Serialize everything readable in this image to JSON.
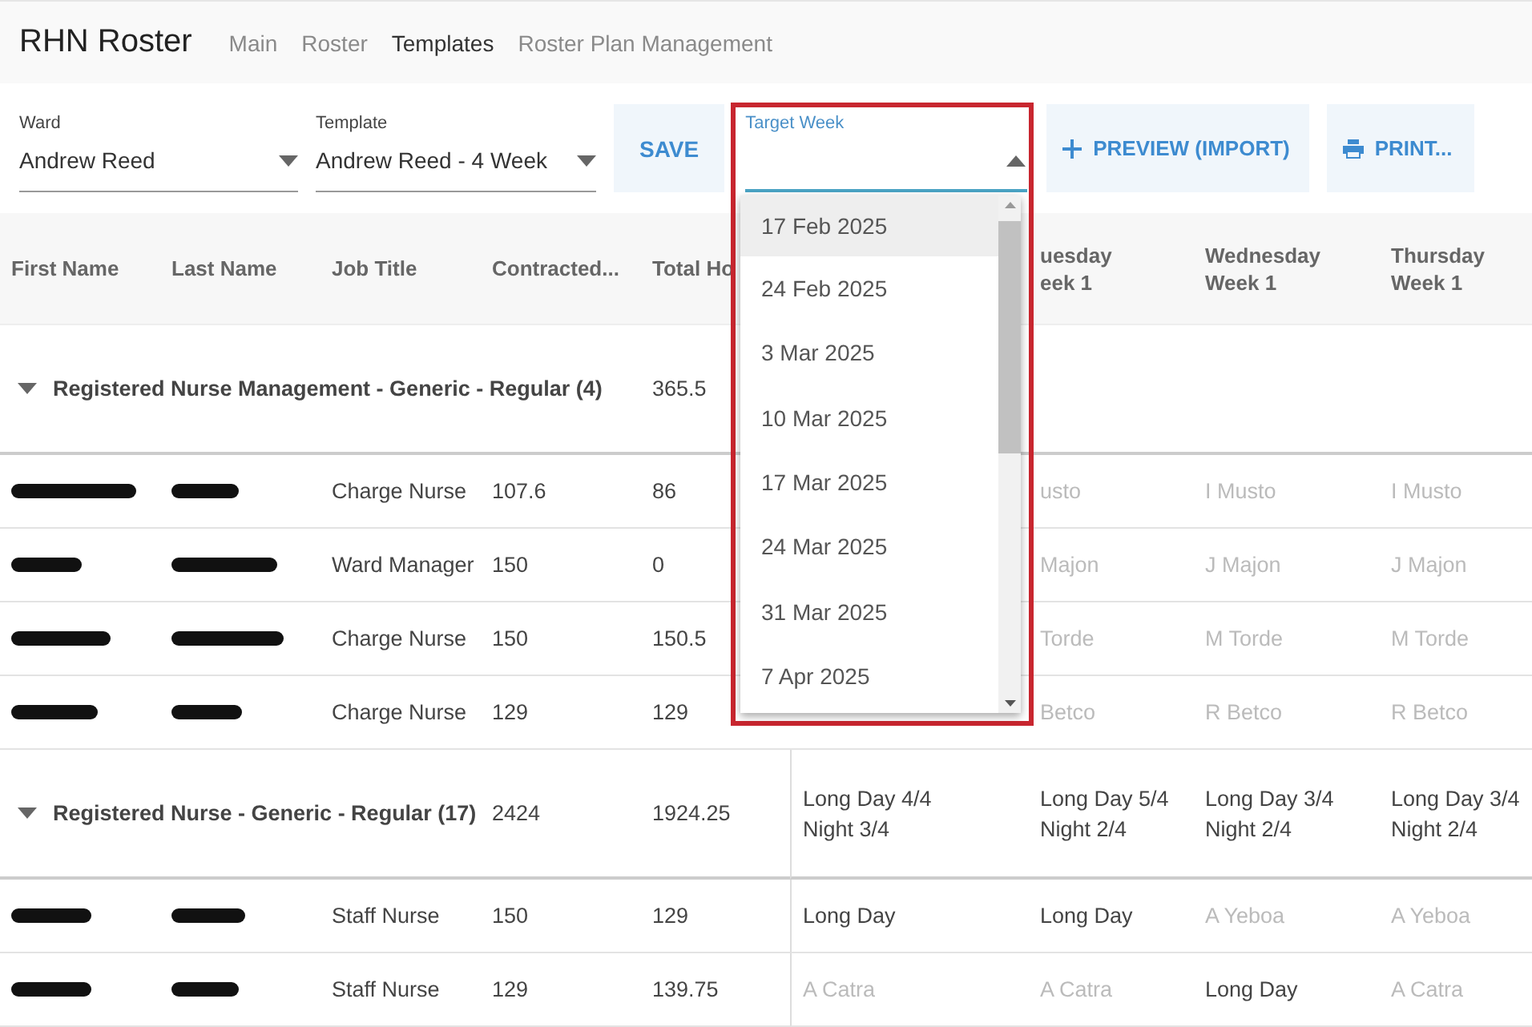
{
  "app": {
    "title": "RHN Roster"
  },
  "nav": [
    {
      "label": "Main",
      "selected": false
    },
    {
      "label": "Roster",
      "selected": false
    },
    {
      "label": "Templates",
      "selected": true
    },
    {
      "label": "Roster Plan Management",
      "selected": false
    }
  ],
  "toolbar": {
    "ward": {
      "label": "Ward",
      "value": "Andrew Reed"
    },
    "template": {
      "label": "Template",
      "value": "Andrew Reed - 4 Week"
    },
    "save_button": "SAVE",
    "target_week": {
      "label": "Target Week",
      "expanded": true,
      "annotation": {
        "kind": "outline"
      },
      "options": [
        {
          "label": "17 Feb 2025",
          "selected": true
        },
        {
          "label": "24 Feb 2025",
          "selected": false
        },
        {
          "label": "3 Mar 2025",
          "selected": false
        },
        {
          "label": "10 Mar 2025",
          "selected": false
        },
        {
          "label": "17 Mar 2025",
          "selected": false
        },
        {
          "label": "24 Mar 2025",
          "selected": false
        },
        {
          "label": "31 Mar 2025",
          "selected": false
        },
        {
          "label": "7 Apr 2025",
          "selected": false
        }
      ]
    },
    "preview_button": "PREVIEW (IMPORT)",
    "print_button": "PRINT..."
  },
  "table": {
    "columns": [
      {
        "label": "First Name"
      },
      {
        "label": "Last Name"
      },
      {
        "label": "Job Title"
      },
      {
        "label": "Contracted..."
      },
      {
        "label": "Total Ho"
      },
      {
        "covered": true
      },
      {
        "label": "uesday\neek 1"
      },
      {
        "label": "Wednesday\nWeek 1"
      },
      {
        "label": "Thursday\nWeek 1"
      }
    ],
    "rows": [
      {
        "kind": "group",
        "expanded": true,
        "label": "Registered Nurse Management - Generic - Regular (4)",
        "total": "365.5"
      },
      {
        "kind": "person",
        "name_redacted": true,
        "job_title": "Charge Nurse",
        "contracted": "107.6",
        "total": "86",
        "cells": {
          "column_7": {
            "text": "usto",
            "muted": true
          },
          "column_8": {
            "text": "I Musto",
            "muted": true
          },
          "column_9": {
            "text": "I Musto",
            "muted": true
          }
        }
      },
      {
        "kind": "person",
        "name_redacted": true,
        "job_title": "Ward Manager",
        "contracted": "150",
        "total": "0",
        "cells": {
          "column_7": {
            "text": "Majon",
            "muted": true
          },
          "column_8": {
            "text": "J Majon",
            "muted": true
          },
          "column_9": {
            "text": "J Majon",
            "muted": true
          }
        }
      },
      {
        "kind": "person",
        "name_redacted": true,
        "job_title": "Charge Nurse",
        "contracted": "150",
        "total": "150.5",
        "cells": {
          "column_7": {
            "text": "Torde",
            "muted": true
          },
          "column_8": {
            "text": "M Torde",
            "muted": true
          },
          "column_9": {
            "text": "M Torde",
            "muted": true
          }
        }
      },
      {
        "kind": "person",
        "name_redacted": true,
        "job_title": "Charge Nurse",
        "contracted": "129",
        "total": "129",
        "cells": {
          "column_7": {
            "text": "Betco",
            "muted": true
          },
          "column_8": {
            "text": "R Betco",
            "muted": true
          },
          "column_9": {
            "text": "R Betco",
            "muted": true
          }
        }
      },
      {
        "kind": "group",
        "expanded": true,
        "label": "Registered Nurse - Generic - Regular (17)",
        "contracted": "2424",
        "total": "1924.25",
        "cells": {
          "column_6": {
            "text": "Long Day 4/4\nNight 3/4",
            "muted": false
          },
          "column_7": {
            "text": "Long Day 5/4\nNight 2/4",
            "muted": false
          },
          "column_8": {
            "text": "Long Day 3/4\nNight 2/4",
            "muted": false
          },
          "column_9": {
            "text": "Long Day 3/4\nNight 2/4",
            "muted": false
          }
        }
      },
      {
        "kind": "person",
        "name_redacted": true,
        "job_title": "Staff Nurse",
        "contracted": "150",
        "total": "129",
        "cells": {
          "column_6": {
            "text": "Long Day",
            "muted": false
          },
          "column_7": {
            "text": "Long Day",
            "muted": false
          },
          "column_8": {
            "text": "A Yeboa",
            "muted": true
          },
          "column_9": {
            "text": "A Yeboa",
            "muted": true
          }
        }
      },
      {
        "kind": "person",
        "name_redacted": true,
        "job_title": "Staff Nurse",
        "contracted": "129",
        "total": "139.75",
        "cells": {
          "column_6": {
            "text": "A Catra",
            "muted": true
          },
          "column_7": {
            "text": "A Catra",
            "muted": true
          },
          "column_8": {
            "text": "Long Day",
            "muted": false
          },
          "column_9": {
            "text": "A Catra",
            "muted": true
          }
        }
      }
    ]
  }
}
